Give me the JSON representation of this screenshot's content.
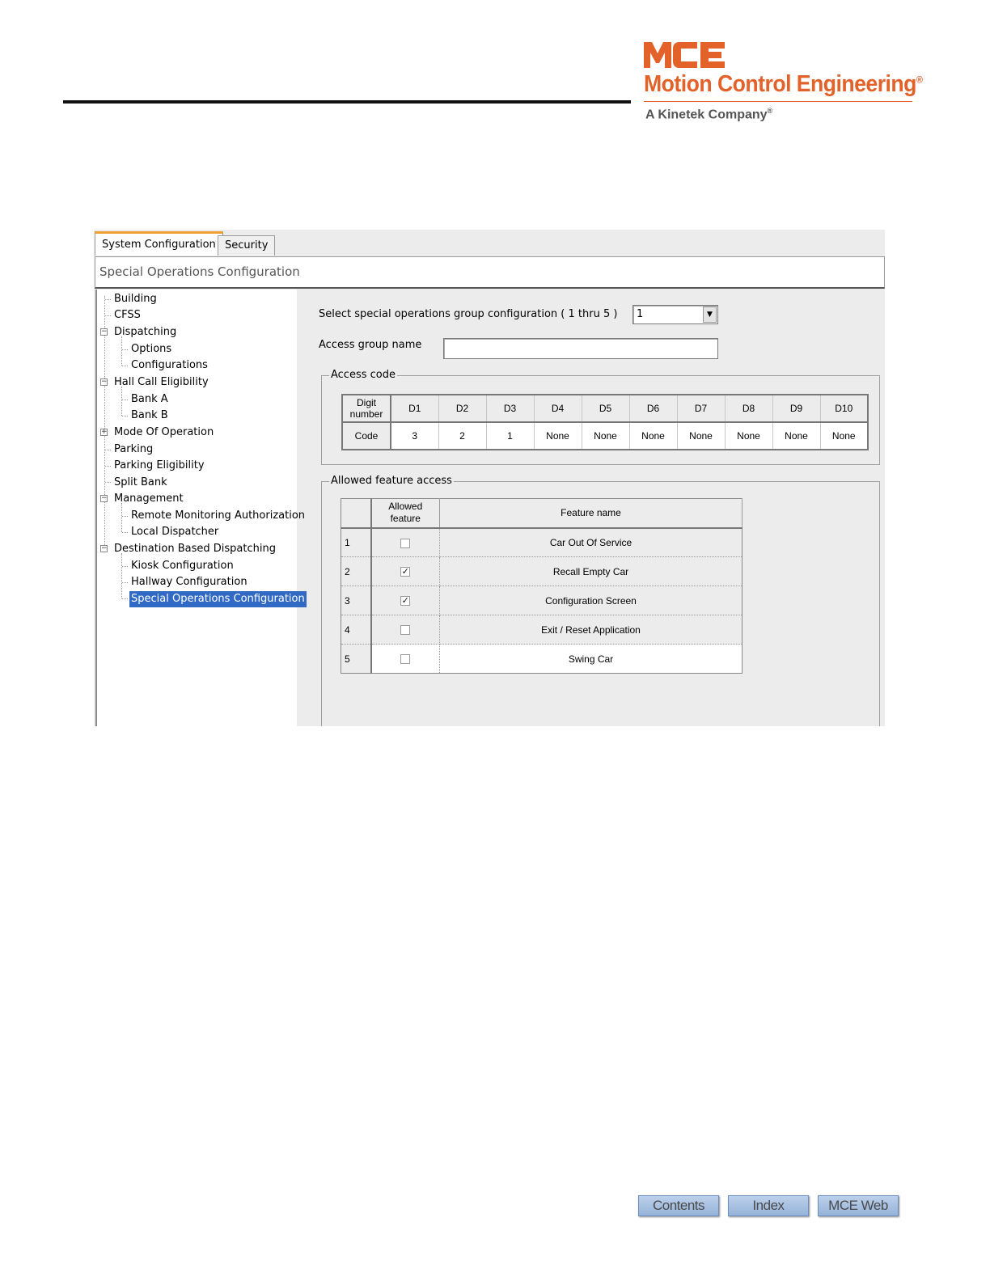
{
  "brand": {
    "name": "Motion Control Engineering",
    "tagline": "A Kinetek Company",
    "reg_mark": "®",
    "logo_letters": "MCE",
    "color": "#e2622a"
  },
  "tabs": [
    {
      "label": "System Configuration",
      "active": true
    },
    {
      "label": "Security",
      "active": false
    }
  ],
  "panel_title": "Special Operations Configuration",
  "tree": [
    {
      "label": "Building"
    },
    {
      "label": "CFSS"
    },
    {
      "label": "Dispatching"
    },
    {
      "label": "Options"
    },
    {
      "label": "Configurations"
    },
    {
      "label": "Hall Call Eligibility"
    },
    {
      "label": "Bank A"
    },
    {
      "label": "Bank B"
    },
    {
      "label": "Mode Of Operation"
    },
    {
      "label": "Parking"
    },
    {
      "label": "Parking Eligibility"
    },
    {
      "label": "Split Bank"
    },
    {
      "label": "Management"
    },
    {
      "label": "Remote Monitoring Authorization"
    },
    {
      "label": "Local Dispatcher"
    },
    {
      "label": "Destination Based Dispatching"
    },
    {
      "label": "Kiosk Configuration"
    },
    {
      "label": "Hallway Configuration"
    },
    {
      "label": "Special Operations Configuration",
      "selected": true
    }
  ],
  "tree_toggles": {
    "collapse": "−",
    "expand": "+"
  },
  "form": {
    "group_select_label": "Select special operations group configuration ( 1 thru 5 )",
    "group_select_value": "1",
    "dropdown_glyph": "▼",
    "access_group_label": "Access group name",
    "access_group_value": ""
  },
  "access_code": {
    "legend": "Access code",
    "digit_header": "Digit number",
    "code_label": "Code",
    "digits": [
      "D1",
      "D2",
      "D3",
      "D4",
      "D5",
      "D6",
      "D7",
      "D8",
      "D9",
      "D10"
    ],
    "codes": [
      "3",
      "2",
      "1",
      "None",
      "None",
      "None",
      "None",
      "None",
      "None",
      "None"
    ]
  },
  "features": {
    "legend": "Allowed feature access",
    "col_allowed": "Allowed feature",
    "col_name": "Feature name",
    "check_glyph": "✓",
    "rows": [
      {
        "num": "1",
        "allowed": false,
        "name": "Car Out Of Service"
      },
      {
        "num": "2",
        "allowed": true,
        "name": "Recall Empty Car"
      },
      {
        "num": "3",
        "allowed": true,
        "name": "Configuration Screen"
      },
      {
        "num": "4",
        "allowed": false,
        "name": "Exit / Reset Application"
      },
      {
        "num": "5",
        "allowed": false,
        "name": "Swing Car"
      }
    ]
  },
  "nav_buttons": {
    "contents": "Contents",
    "index": "Index",
    "web": "MCE Web"
  }
}
